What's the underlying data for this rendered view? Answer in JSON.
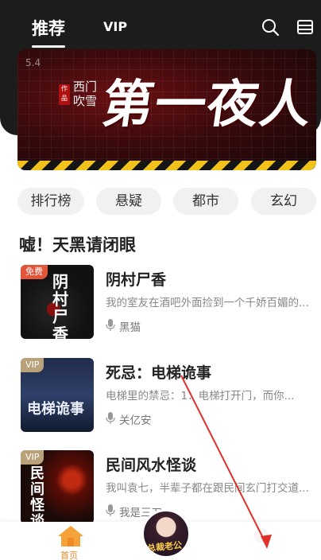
{
  "header": {
    "tabs": [
      {
        "label": "推荐",
        "active": true
      },
      {
        "label": "VIP",
        "active": false
      }
    ],
    "icons": [
      "search-icon",
      "bookshelf-icon"
    ]
  },
  "banner": {
    "date": "5.4",
    "seal": "作品",
    "author": "西门吹雪",
    "title": "第一夜人"
  },
  "categories": [
    "排行榜",
    "悬疑",
    "都市",
    "玄幻"
  ],
  "section": {
    "title": "嘘！天黑请闭眼"
  },
  "books": [
    {
      "badge": "免费",
      "cover_text": "阴村尸香",
      "title": "阴村尸香",
      "desc": "我的室友在酒吧外面捡到一个千娇百媚的...",
      "author": "黑猫"
    },
    {
      "badge": "VIP",
      "cover_text": "电梯诡事",
      "title": "死忌：电梯诡事",
      "desc": "电梯里的禁忌：1：电梯打开门，而你...",
      "author": "关亿安"
    },
    {
      "badge": "VIP",
      "cover_text": "民间怪谈",
      "title": "民间风水怪谈",
      "desc": "我叫袁七，半辈子都在跟民间玄门打交道...",
      "author": "我是三刀"
    }
  ],
  "bottom_nav": {
    "home_label": "首页",
    "center_caption": "总裁老公"
  },
  "colors": {
    "accent": "#f08a24",
    "header_bg": "#1c1c1c",
    "annotation": "#e0302a"
  }
}
